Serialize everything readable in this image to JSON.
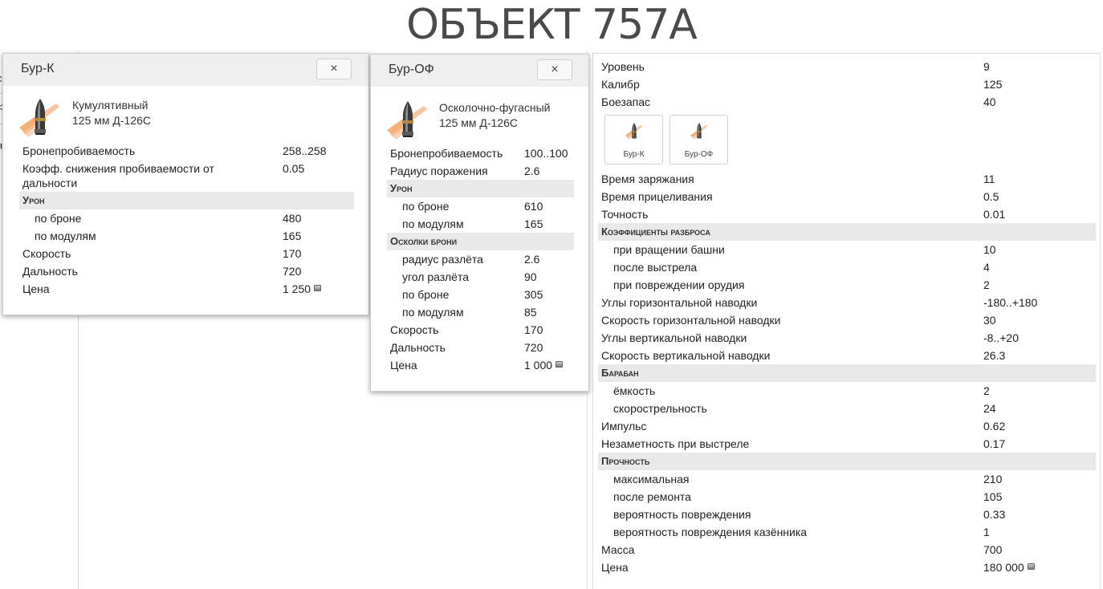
{
  "title": "ОБЪЕКТ 757А",
  "background_fragments": [
    "c",
    "<",
    "я"
  ],
  "stats": {
    "rows": [
      {
        "label": "Уровень",
        "value": "9",
        "kind": "row"
      },
      {
        "label": "Калибр",
        "value": "125",
        "kind": "row"
      },
      {
        "label": "Боезапас",
        "value": "40",
        "kind": "row"
      },
      {
        "label": "Время заряжания",
        "value": "11",
        "kind": "row"
      },
      {
        "label": "Время прицеливания",
        "value": "0.5",
        "kind": "row"
      },
      {
        "label": "Точность",
        "value": "0.01",
        "kind": "row"
      },
      {
        "label": "Коэффициенты разброса",
        "value": "",
        "kind": "section"
      },
      {
        "label": "при вращении башни",
        "value": "10",
        "kind": "sub"
      },
      {
        "label": "после выстрела",
        "value": "4",
        "kind": "sub"
      },
      {
        "label": "при повреждении орудия",
        "value": "2",
        "kind": "sub"
      },
      {
        "label": "Углы горизонтальной наводки",
        "value": "-180..+180",
        "kind": "row"
      },
      {
        "label": "Скорость горизонтальной наводки",
        "value": "30",
        "kind": "row"
      },
      {
        "label": "Углы вертикальной наводки",
        "value": "-8..+20",
        "kind": "row"
      },
      {
        "label": "Скорость вертикальной наводки",
        "value": "26.3",
        "kind": "row"
      },
      {
        "label": "Барабан",
        "value": "",
        "kind": "section"
      },
      {
        "label": "ёмкость",
        "value": "2",
        "kind": "sub"
      },
      {
        "label": "скорострельность",
        "value": "24",
        "kind": "sub"
      },
      {
        "label": "Импульс",
        "value": "0.62",
        "kind": "row"
      },
      {
        "label": "Незаметность при выстреле",
        "value": "0.17",
        "kind": "row"
      },
      {
        "label": "Прочность",
        "value": "",
        "kind": "section"
      },
      {
        "label": "максимальная",
        "value": "210",
        "kind": "sub"
      },
      {
        "label": "после ремонта",
        "value": "105",
        "kind": "sub"
      },
      {
        "label": "вероятность повреждения",
        "value": "0.33",
        "kind": "sub"
      },
      {
        "label": "вероятность повреждения казённика",
        "value": "1",
        "kind": "sub"
      },
      {
        "label": "Масса",
        "value": "700",
        "kind": "row"
      },
      {
        "label": "Цена",
        "value": "180 000",
        "kind": "row",
        "currency_icon": "silver-coin-icon"
      }
    ],
    "shell_buttons": [
      {
        "label": "Бур-К",
        "icon": "shell-icon"
      },
      {
        "label": "Бур-ОФ",
        "icon": "shell-icon"
      }
    ]
  },
  "popups": [
    {
      "title": "Бур-К",
      "close_label": "×",
      "shell_type": "Кумулятивный",
      "gun": "125 мм Д-126С",
      "rows": [
        {
          "label": "Бронепробиваемость",
          "value": "258..258",
          "kind": "row"
        },
        {
          "label": "Коэфф. снижения пробиваемости от дальности",
          "value": "0.05",
          "kind": "tall"
        },
        {
          "label": "Урон",
          "value": "",
          "kind": "section"
        },
        {
          "label": "по броне",
          "value": "480",
          "kind": "sub"
        },
        {
          "label": "по модулям",
          "value": "165",
          "kind": "sub"
        },
        {
          "label": "Скорость",
          "value": "170",
          "kind": "row"
        },
        {
          "label": "Дальность",
          "value": "720",
          "kind": "row"
        },
        {
          "label": "Цена",
          "value": "1 250",
          "kind": "row",
          "currency_icon": "silver-coin-icon"
        }
      ]
    },
    {
      "title": "Бур-ОФ",
      "close_label": "×",
      "shell_type": "Осколочно-фугасный",
      "gun": "125 мм Д-126С",
      "rows": [
        {
          "label": "Бронепробиваемость",
          "value": "100..100",
          "kind": "row"
        },
        {
          "label": "Радиус поражения",
          "value": "2.6",
          "kind": "row"
        },
        {
          "label": "Урон",
          "value": "",
          "kind": "section"
        },
        {
          "label": "по броне",
          "value": "610",
          "kind": "sub"
        },
        {
          "label": "по модулям",
          "value": "165",
          "kind": "sub"
        },
        {
          "label": "Осколки брони",
          "value": "",
          "kind": "section"
        },
        {
          "label": "радиус разлёта",
          "value": "2.6",
          "kind": "sub"
        },
        {
          "label": "угол разлёта",
          "value": "90",
          "kind": "sub"
        },
        {
          "label": "по броне",
          "value": "305",
          "kind": "sub"
        },
        {
          "label": "по модулям",
          "value": "85",
          "kind": "sub"
        },
        {
          "label": "Скорость",
          "value": "170",
          "kind": "row"
        },
        {
          "label": "Дальность",
          "value": "720",
          "kind": "row"
        },
        {
          "label": "Цена",
          "value": "1 000",
          "kind": "row",
          "currency_icon": "silver-coin-icon"
        }
      ]
    }
  ]
}
